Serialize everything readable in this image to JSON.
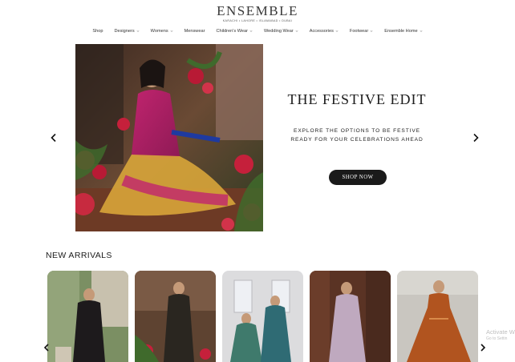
{
  "header": {
    "logo_text": "ENSEMBLE",
    "logo_tagline": "KARACHI • LAHORE • ISLAMABAD • DUBAI"
  },
  "nav": {
    "items": [
      {
        "label": "Shop"
      },
      {
        "label": "Designers"
      },
      {
        "label": "Womens"
      },
      {
        "label": "Menswear"
      },
      {
        "label": "Children's Wear"
      },
      {
        "label": "Wedding Wear"
      },
      {
        "label": "Accessories"
      },
      {
        "label": "Footwear"
      },
      {
        "label": "Ensemble Home"
      }
    ]
  },
  "hero": {
    "title": "THE FESTIVE EDIT",
    "subtitle_line1": "EXPLORE THE OPTIONS TO BE FESTIVE",
    "subtitle_line2": "READY FOR YOUR CELEBRATIONS AHEAD",
    "button_label": "SHOP NOW",
    "prev_icon": "chevron-left-icon",
    "next_icon": "chevron-right-icon"
  },
  "new_arrivals": {
    "title": "NEW ARRIVALS",
    "products": [
      {
        "name": "product-1",
        "palette": [
          "#6f8a5a",
          "#1d1a1c"
        ]
      },
      {
        "name": "product-2",
        "palette": [
          "#6a4a37",
          "#2a2620"
        ]
      },
      {
        "name": "product-3",
        "palette": [
          "#d9d9db",
          "#3f7a6c"
        ]
      },
      {
        "name": "product-4",
        "palette": [
          "#5a3324",
          "#bfa9bf"
        ]
      },
      {
        "name": "product-5",
        "palette": [
          "#c9c6c0",
          "#b1541f"
        ]
      }
    ]
  },
  "watermark": {
    "line1": "Activate W",
    "line2": "Go to Settin"
  },
  "colors": {
    "button_bg": "#1a1a1a",
    "text_dark": "#1c1c1c"
  }
}
